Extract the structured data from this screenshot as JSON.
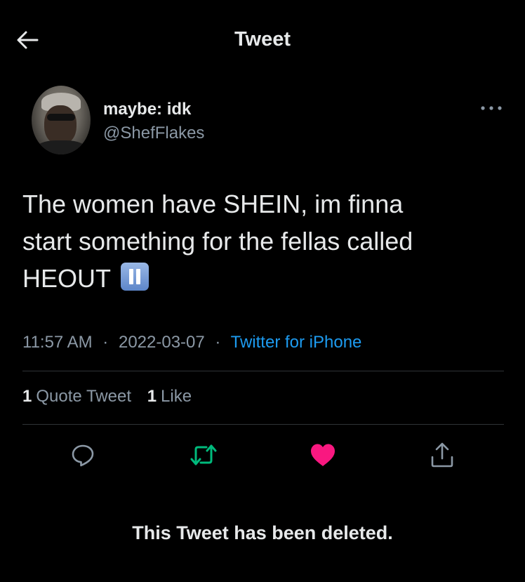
{
  "header": {
    "back_icon": "arrow-left-icon",
    "title": "Tweet"
  },
  "author": {
    "display_name": "maybe: idk",
    "handle": "@ShefFlakes",
    "avatar_icon": "avatar-photo"
  },
  "more_icon": "more-horizontal-icon",
  "tweet": {
    "lines": [
      "The women have SHEIN, im finna",
      "start something for the fellas called",
      "HEOUT"
    ],
    "emoji": "pause-button-emoji"
  },
  "meta": {
    "time": "11:57 AM",
    "separator": "·",
    "date": "2022-03-07",
    "source": "Twitter for iPhone"
  },
  "stats": [
    {
      "count": "1",
      "label": "Quote Tweet"
    },
    {
      "count": "1",
      "label": "Like"
    }
  ],
  "actions": [
    {
      "name": "reply",
      "icon": "reply-icon",
      "color": "#8b98a5"
    },
    {
      "name": "retweet",
      "icon": "retweet-icon",
      "color": "#00ba7c"
    },
    {
      "name": "like",
      "icon": "heart-icon",
      "color": "#f91880"
    },
    {
      "name": "share",
      "icon": "share-icon",
      "color": "#8b98a5"
    }
  ],
  "deleted_note": "This Tweet has been deleted.",
  "colors": {
    "background": "#000000",
    "text": "#e7e9ea",
    "secondary": "#8b98a5",
    "link": "#1d9bf0",
    "divider": "#2f3336",
    "retweeted": "#00ba7c",
    "liked": "#f91880"
  }
}
